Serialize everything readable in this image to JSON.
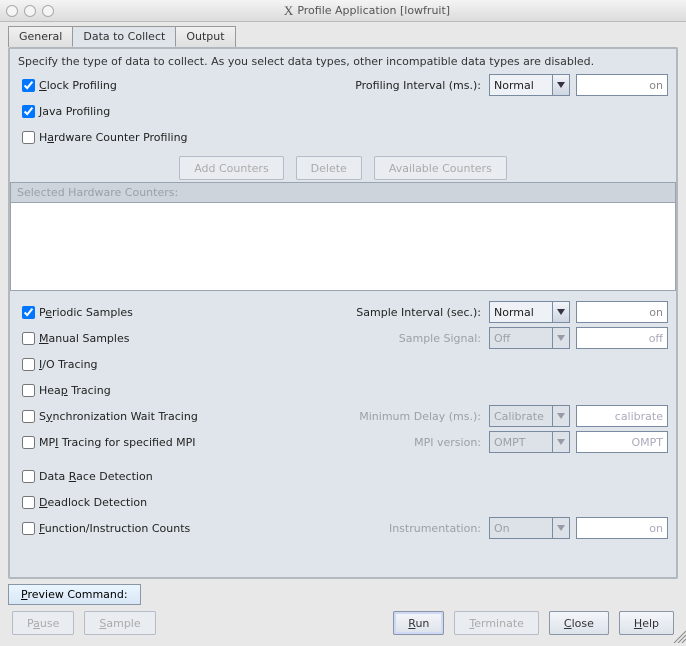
{
  "window": {
    "title": "Profile Application [lowfruit]",
    "xlogo": "X"
  },
  "tabs": {
    "general": "General",
    "data": "Data to Collect",
    "output": "Output"
  },
  "desc": "Specify the type of data to collect.  As you select data types, other incompatible data types are disabled.",
  "rows": {
    "clock": "Clock Profiling",
    "java": "Java Profiling",
    "hw": "Hardware Counter Profiling",
    "periodic": "Periodic Samples",
    "manual": "Manual Samples",
    "io": "I/O Tracing",
    "heap": "Heap Tracing",
    "sync": "Synchronization Wait Tracing",
    "mpi": "MPI Tracing for specified MPI",
    "race": "Data Race Detection",
    "dead": "Deadlock Detection",
    "func": "Function/Instruction Counts"
  },
  "labels": {
    "profInterval": "Profiling Interval (ms.):",
    "sampleInterval": "Sample Interval (sec.):",
    "sampleSignal": "Sample Signal:",
    "minDelay": "Minimum Delay (ms.):",
    "mpiVer": "MPI version:",
    "instr": "Instrumentation:",
    "selectedHW": "Selected Hardware Counters:"
  },
  "combos": {
    "normal1": "Normal",
    "normal2": "Normal",
    "off": "Off",
    "calibrate": "Calibrate",
    "ompt": "OMPT",
    "on": "On"
  },
  "inputs": {
    "on1": "on",
    "on2": "on",
    "off": "off",
    "calibrate": "calibrate",
    "ompt": "OMPT",
    "on3": "on"
  },
  "buttons": {
    "addCounters": "Add Counters",
    "delete": "Delete",
    "availCounters": "Available Counters",
    "preview": "Preview Command:",
    "pause": "Pause",
    "sample": "Sample",
    "run": "Run",
    "terminate": "Terminate",
    "close": "Close",
    "help": "Help"
  },
  "checked": {
    "clock": true,
    "java": true,
    "hw": false,
    "periodic": true,
    "manual": false,
    "io": false,
    "heap": false,
    "sync": false,
    "mpi": false,
    "race": false,
    "dead": false,
    "func": false
  }
}
